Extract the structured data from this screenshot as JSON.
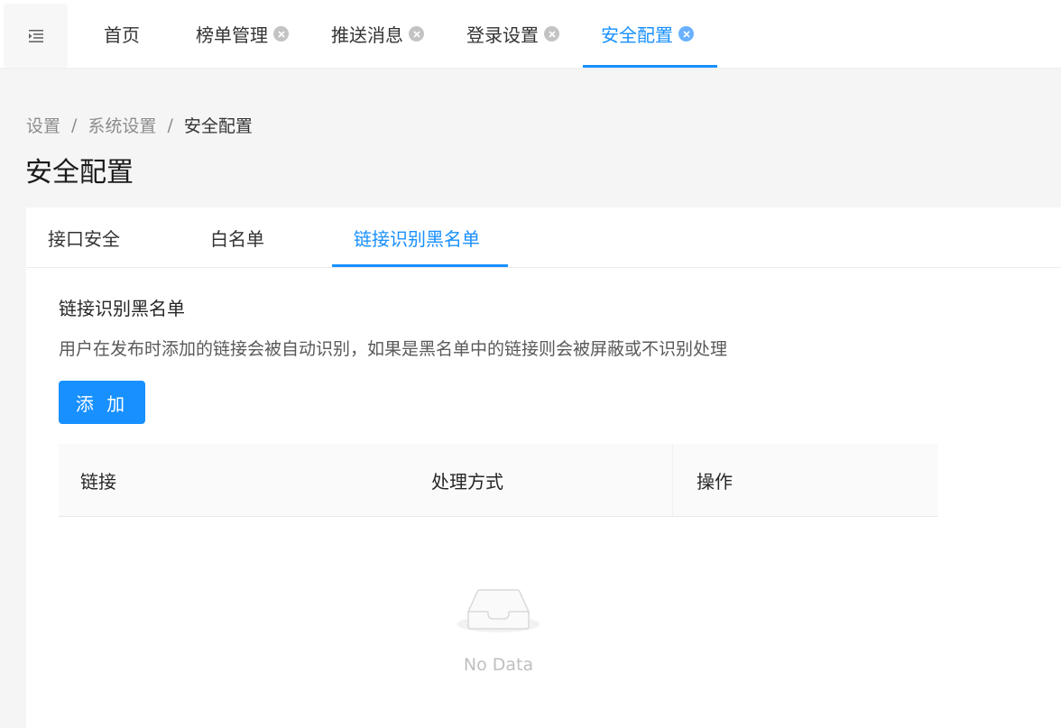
{
  "top_tabs": [
    {
      "label": "首页",
      "closable": false,
      "active": false
    },
    {
      "label": "榜单管理",
      "closable": true,
      "active": false
    },
    {
      "label": "推送消息",
      "closable": true,
      "active": false
    },
    {
      "label": "登录设置",
      "closable": true,
      "active": false
    },
    {
      "label": "安全配置",
      "closable": true,
      "active": true
    }
  ],
  "breadcrumb": {
    "items": [
      "设置",
      "系统设置",
      "安全配置"
    ],
    "separator": "/"
  },
  "page_title": "安全配置",
  "inner_tabs": [
    {
      "label": "接口安全",
      "active": false
    },
    {
      "label": "白名单",
      "active": false
    },
    {
      "label": "链接识别黑名单",
      "active": true
    }
  ],
  "section": {
    "title": "链接识别黑名单",
    "description": "用户在发布时添加的链接会被自动识别，如果是黑名单中的链接则会被屏蔽或不识别处理",
    "add_label": "添 加"
  },
  "table": {
    "columns": [
      "链接",
      "处理方式",
      "操作"
    ],
    "rows": [],
    "empty_text": "No Data"
  },
  "colors": {
    "accent": "#1890ff",
    "background": "#f5f5f5",
    "card": "#ffffff"
  },
  "icons": {
    "menu_toggle": "menu-fold-icon",
    "tab_close": "close-circle-icon",
    "empty": "inbox-empty-icon"
  }
}
